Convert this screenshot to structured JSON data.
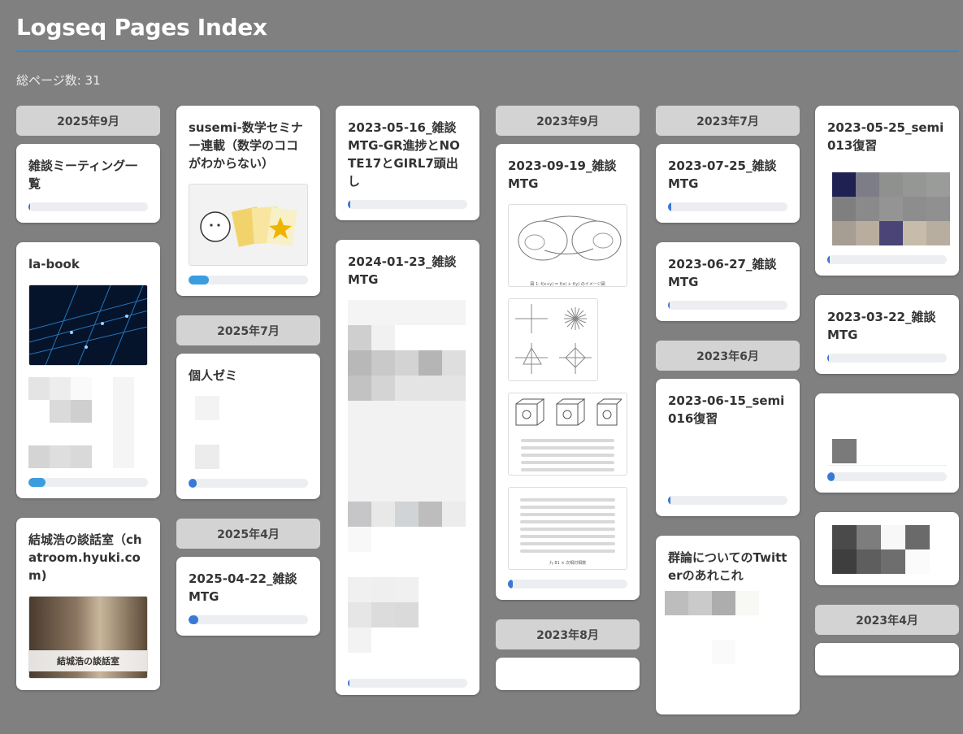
{
  "header": {
    "title": "Logseq Pages Index",
    "total_pages": "総ページ数: 31"
  },
  "colors": {
    "background": "#808080",
    "accent_rule": "#3c87c9",
    "progress_fill": "#3a78d6",
    "progress_fill_alt": "#3a9ddf",
    "month_header": "#d3d3d3",
    "card": "#ffffff"
  },
  "columns": [
    {
      "month": "2025年9月",
      "cards": [
        {
          "title": "雑談ミーティング一覧",
          "progress": 0.01
        },
        {
          "title": "la-book",
          "progress": 0.14
        },
        {
          "title": "結城浩の談話室（chatroom.hyuki.com)",
          "banner_caption": "結城浩の談話室"
        }
      ]
    },
    {
      "cards": [
        {
          "title": "susemi-数学セミナー連載（数学のココがわからない）",
          "progress": 0.17
        }
      ],
      "month2": "2025年7月",
      "cards2": [
        {
          "title": "個人ゼミ",
          "progress": 0.07
        }
      ],
      "month3": "2025年4月",
      "cards3": [
        {
          "title": "2025-04-22_雑談MTG",
          "progress": 0.08
        }
      ]
    },
    {
      "cards": [
        {
          "title": "2023-05-16_雑談MTG-GR進捗とNOTE17とGIRL7頭出し",
          "progress": 0.02
        },
        {
          "title": "2024-01-23_雑談MTG",
          "progress": 0.01
        }
      ]
    },
    {
      "month": "2023年9月",
      "cards": [
        {
          "title": "2023-09-19_雑談MTG",
          "progress": 0.04,
          "figure_caption": "図 1: f(x+y) = f(x) + f(y) のイメージ図",
          "table_caption": "九 81 × 次相対相数"
        }
      ],
      "month2": "2023年8月"
    },
    {
      "month": "2023年7月",
      "cards": [
        {
          "title": "2023-07-25_雑談MTG",
          "progress": 0.03
        },
        {
          "title": "2023-06-27_雑談MTG",
          "progress": 0.01
        }
      ],
      "month2": "2023年6月",
      "cards2": [
        {
          "title": "2023-06-15_semi016復習",
          "progress": 0.02
        },
        {
          "title": "群論についてのTwitterのあれこれ"
        }
      ]
    },
    {
      "cards": [
        {
          "title": "2023-05-25_semi013復習",
          "progress": 0.02
        },
        {
          "title": "2023-03-22_雑談MTG",
          "progress": 0.01
        },
        {
          "title": "",
          "progress": 0.06
        },
        {
          "title": ""
        }
      ],
      "month2": "2023年4月"
    }
  ]
}
